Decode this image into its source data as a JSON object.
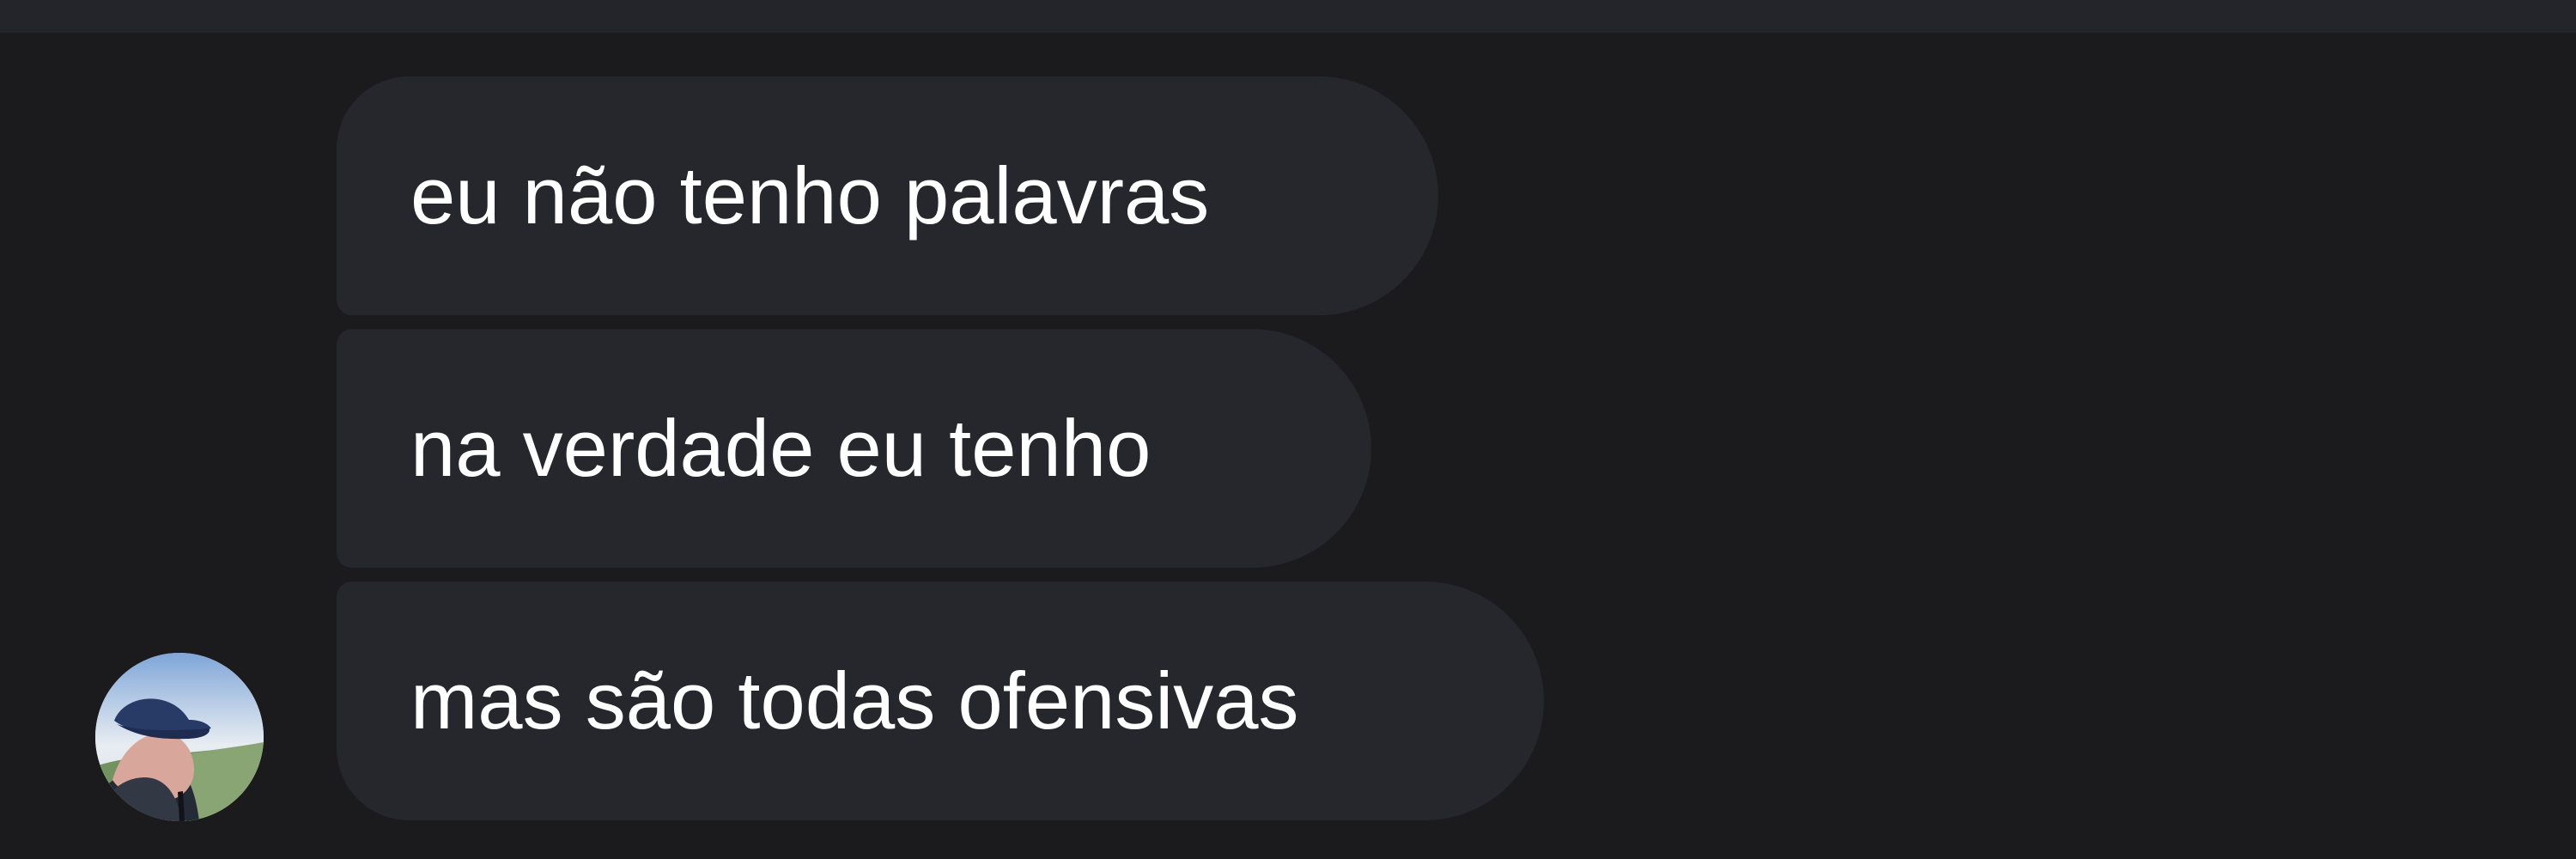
{
  "messages": [
    {
      "text": "eu não tenho palavras"
    },
    {
      "text": "na verdade eu tenho"
    },
    {
      "text": "mas são todas ofensivas"
    }
  ],
  "sender": {
    "avatar_icon": "profile-photo"
  },
  "colors": {
    "background": "#1b1b1d",
    "top_bar": "#23252b",
    "bubble": "#25272c",
    "text": "#ffffff"
  }
}
